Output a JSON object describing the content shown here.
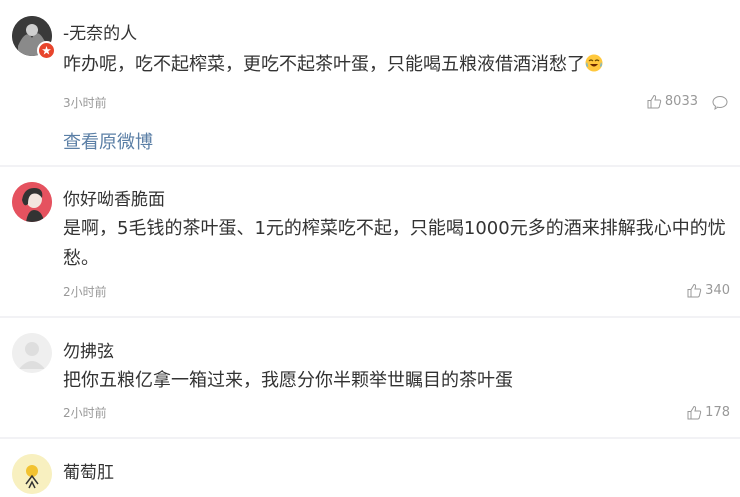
{
  "original": {
    "author": "-无奈的人",
    "text": "咋办呢，吃不起榨菜，更吃不起茶叶蛋，只能喝五粮液借酒消愁了",
    "emoji": "crying-laughing-emoji",
    "time": "3小时前",
    "likes": "8033",
    "view_original_label": "查看原微博"
  },
  "comments": [
    {
      "author": "你好呦香脆面",
      "text": "是啊，5毛钱的茶叶蛋、1元的榨菜吃不起，只能喝1000元多的酒来排解我心中的忧愁。",
      "time": "2小时前",
      "likes": "340"
    },
    {
      "author": "勿拂弦",
      "text": "把你五粮亿拿一箱过来，我愿分你半颗举世瞩目的茶叶蛋",
      "time": "2小时前",
      "likes": "178"
    },
    {
      "author": "葡萄肛",
      "text": ""
    }
  ],
  "colors": {
    "link": "#5b7fa6",
    "muted": "#999999",
    "background": "#f2f2f5",
    "badge": "#e8452c"
  }
}
